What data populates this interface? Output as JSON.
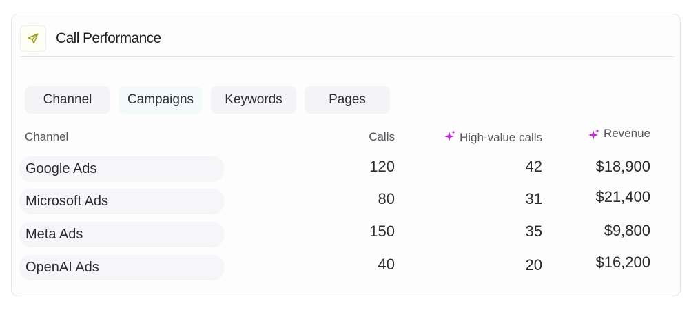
{
  "header": {
    "title": "Call Performance",
    "icon": "send-icon"
  },
  "tabs": [
    {
      "label": "Channel",
      "active": false
    },
    {
      "label": "Campaigns",
      "active": true
    },
    {
      "label": "Keywords",
      "active": false
    },
    {
      "label": "Pages",
      "active": false
    }
  ],
  "table": {
    "columns": {
      "channel": "Channel",
      "calls": "Calls",
      "high_value": "High-value calls",
      "revenue": "Revenue"
    },
    "rows": [
      {
        "channel": "Google Ads",
        "calls": "120",
        "high_value": "42",
        "revenue": "$18,900"
      },
      {
        "channel": "Microsoft Ads",
        "calls": "80",
        "high_value": "31",
        "revenue": "$21,400"
      },
      {
        "channel": "Meta Ads",
        "calls": "150",
        "high_value": "35",
        "revenue": "$9,800"
      },
      {
        "channel": "OpenAI Ads",
        "calls": "40",
        "high_value": "20",
        "revenue": "$16,200"
      }
    ]
  },
  "colors": {
    "accent_sparkle": "#c026d3",
    "logo_icon": "#9aa017"
  }
}
